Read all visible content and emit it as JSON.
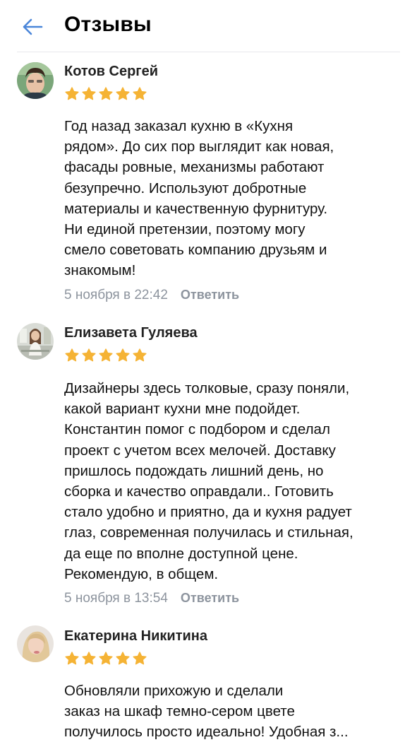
{
  "header": {
    "title": "Отзывы",
    "back_icon": "arrow-left-icon"
  },
  "colors": {
    "accent": "#4a86d9",
    "star": "#f5b335",
    "meta": "#8d949e"
  },
  "reviews": [
    {
      "author": "Котов Сергей",
      "rating": 5,
      "text": "Год назад заказал кухню в «Кухня\nрядом». До сих пор выглядит как новая,\nфасады ровные, механизмы работают\nбезупречно. Используют добротные\nматериалы и качественную фурнитуру.\nНи единой претензии, поэтому могу\nсмело советовать компанию друзьям и\nзнакомым!",
      "date": "5 ноября в 22:42",
      "reply_label": "Ответить"
    },
    {
      "author": "Елизавета Гуляева",
      "rating": 5,
      "text": "Дизайнеры здесь толковые, сразу поняли,\nкакой вариант кухни мне подойдет.\nКонстантин помог с подбором и сделал\nпроект с учетом всех мелочей. Доставку\nпришлось подождать лишний день, но\nсборка и качество оправдали.. Готовить\nстало удобно и приятно, да и кухня радует\nглаз, современная получилась и стильная,\nда еще по вполне доступной цене.\nРекомендую, в общем.",
      "date": "5 ноября в 13:54",
      "reply_label": "Ответить"
    },
    {
      "author": "Екатерина Никитина",
      "rating": 5,
      "text": "Обновляли прихожую и сделали\nзаказ на шкаф темно-сером цвете\nполучилось просто идеально! Удобная з...",
      "date": "",
      "reply_label": ""
    }
  ]
}
